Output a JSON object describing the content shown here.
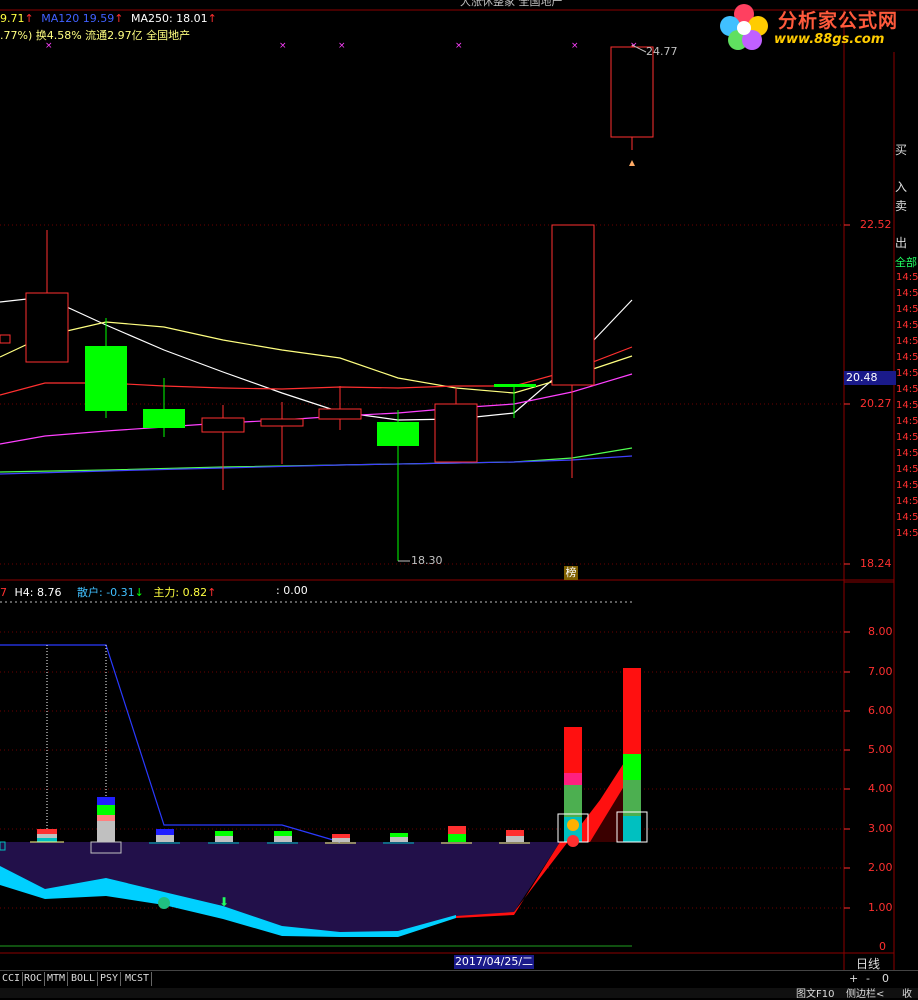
{
  "window": {
    "title": "大涨休整家 全国地产"
  },
  "header": {
    "ma_short": "9.71",
    "ma120_label": "MA120",
    "ma120_value": "19.59",
    "ma250_label": "MA250:",
    "ma250_value": "18.01",
    "stats": ".77%) 换4.58% 流通2.97亿 全国地产"
  },
  "logo": {
    "title": "分析家公式网",
    "url": "www.88gs.com"
  },
  "price_axis": {
    "labels": [
      "22.52",
      "20.27",
      "18.24"
    ],
    "current": "20.48"
  },
  "annotations": {
    "high": "24.77",
    "low": "18.30",
    "badge": "榜"
  },
  "indicator_header": {
    "h4_label": "H4:",
    "h4_value": "8.76",
    "retail_label": "散户:",
    "retail_value": "-0.31",
    "main_label": "主力:",
    "main_value": "0.82",
    "extra": ": 0.00"
  },
  "indicator_axis": {
    "labels": [
      "8.00",
      "7.00",
      "6.00",
      "5.00",
      "4.00",
      "3.00",
      "2.00",
      "1.00",
      "0"
    ]
  },
  "side_panel": {
    "buy": "买",
    "in": "入",
    "sell": "卖",
    "out": "出",
    "all": "全部",
    "times": [
      "14:5",
      "14:5",
      "14:5",
      "14:5",
      "14:5",
      "14:5",
      "14:5",
      "14:5",
      "14:5",
      "14:5",
      "14:5",
      "14:5",
      "14:5",
      "14:5",
      "14:5",
      "14:5",
      "14:5"
    ]
  },
  "footer": {
    "date": "2017/04/25/二",
    "period": "日线",
    "tabs": [
      "CCI",
      "ROC",
      "MTM",
      "BOLL",
      "PSY",
      "MCST"
    ],
    "controls": [
      "+",
      "-",
      "0"
    ],
    "bottom_items": [
      "图文F10",
      "侧边栏<",
      "收"
    ]
  },
  "colors": {
    "up": "#ff3030",
    "down": "#00ff00",
    "bg": "#000000",
    "grid": "#8b0000"
  }
}
